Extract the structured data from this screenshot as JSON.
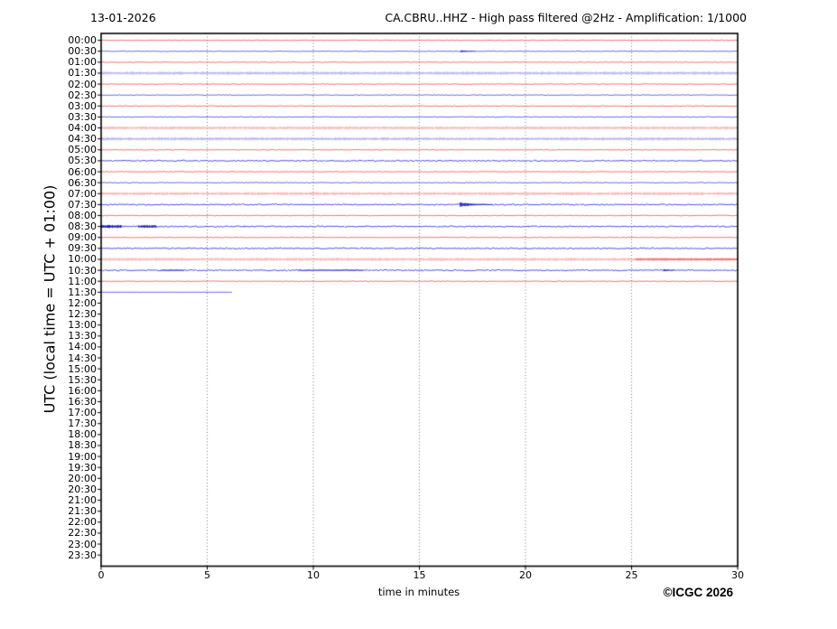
{
  "footer": {
    "copyright": "©ICGC 2026"
  },
  "colors": {
    "background": "#ffffff",
    "frame": "#000000",
    "gridline": "#666666",
    "text": "#000000",
    "trace_red": {
      "base": "#ee5252",
      "light": "#f8a2a2",
      "dark": "#cc2222"
    },
    "trace_blue": {
      "base": "#4747e0",
      "light": "#a2a2f2",
      "dark": "#1c1cbe"
    }
  },
  "chart_data": {
    "type": "helicorder",
    "date": "13-01-2026",
    "title": "CA.CBRU..HHZ - High pass filtered @2Hz - Amplification: 1/1000",
    "xlabel": "time in minutes",
    "ylabel": "UTC (local time = UTC + 01:00)",
    "x_range": [
      0,
      30
    ],
    "x_ticks": [
      0,
      5,
      10,
      15,
      20,
      25,
      30
    ],
    "x_gridlines": [
      5,
      10,
      15,
      20,
      25
    ],
    "minutes_per_row": 30,
    "rows": [
      {
        "label": "00:00",
        "color": "red",
        "noise": "low"
      },
      {
        "label": "00:30",
        "color": "blue",
        "noise": "low",
        "events": [
          {
            "start": 16.95,
            "end": 17.6,
            "amp": 1.1,
            "decay": true,
            "shade": "dark"
          }
        ]
      },
      {
        "label": "01:00",
        "color": "red",
        "noise": "low"
      },
      {
        "label": "01:30",
        "color": "blue",
        "noise": "high"
      },
      {
        "label": "02:00",
        "color": "red",
        "noise": "low"
      },
      {
        "label": "02:30",
        "color": "blue",
        "noise": "low"
      },
      {
        "label": "03:00",
        "color": "red",
        "noise": "low"
      },
      {
        "label": "03:30",
        "color": "blue",
        "noise": "low"
      },
      {
        "label": "04:00",
        "color": "red",
        "noise": "high"
      },
      {
        "label": "04:30",
        "color": "blue",
        "noise": "high"
      },
      {
        "label": "05:00",
        "color": "red",
        "noise": "low"
      },
      {
        "label": "05:30",
        "color": "blue",
        "noise": "med"
      },
      {
        "label": "06:00",
        "color": "red",
        "noise": "low"
      },
      {
        "label": "06:30",
        "color": "blue",
        "noise": "low"
      },
      {
        "label": "07:00",
        "color": "red",
        "noise": "high"
      },
      {
        "label": "07:30",
        "color": "blue",
        "noise": "med",
        "events": [
          {
            "start": 16.9,
            "end": 18.4,
            "amp": 2.8,
            "decay": true,
            "shade": "dark"
          }
        ]
      },
      {
        "label": "08:00",
        "color": "red",
        "noise": "low"
      },
      {
        "label": "08:30",
        "color": "blue",
        "noise": "med",
        "events": [
          {
            "start": 0.0,
            "end": 0.95,
            "amp": 1.5,
            "decay": false,
            "shade": "dark"
          },
          {
            "start": 1.75,
            "end": 2.6,
            "amp": 1.2,
            "decay": false,
            "shade": "dark"
          }
        ]
      },
      {
        "label": "09:00",
        "color": "red",
        "noise": "low"
      },
      {
        "label": "09:30",
        "color": "blue",
        "noise": "med"
      },
      {
        "label": "10:00",
        "color": "red",
        "noise": "high",
        "events": [
          {
            "start": 25.2,
            "end": 30,
            "amp": 1.1,
            "decay": false,
            "shade": "base"
          }
        ]
      },
      {
        "label": "10:30",
        "color": "blue",
        "noise": "med",
        "events": [
          {
            "start": 2.8,
            "end": 3.9,
            "amp": 0.75,
            "decay": false,
            "shade": "base"
          },
          {
            "start": 9.3,
            "end": 12.3,
            "amp": 0.7,
            "decay": false,
            "shade": "base"
          },
          {
            "start": 26.5,
            "end": 27.0,
            "amp": 1.2,
            "decay": true,
            "shade": "dark"
          }
        ]
      },
      {
        "label": "11:00",
        "color": "red",
        "noise": "low"
      },
      {
        "label": "11:30",
        "color": "blue",
        "noise": "flat",
        "end_min": 6.2
      },
      {
        "label": "12:00",
        "color": "red",
        "noise": "none"
      },
      {
        "label": "12:30",
        "color": "blue",
        "noise": "none"
      },
      {
        "label": "13:00",
        "color": "red",
        "noise": "none"
      },
      {
        "label": "13:30",
        "color": "blue",
        "noise": "none"
      },
      {
        "label": "14:00",
        "color": "red",
        "noise": "none"
      },
      {
        "label": "14:30",
        "color": "blue",
        "noise": "none"
      },
      {
        "label": "15:00",
        "color": "red",
        "noise": "none"
      },
      {
        "label": "15:30",
        "color": "blue",
        "noise": "none"
      },
      {
        "label": "16:00",
        "color": "red",
        "noise": "none"
      },
      {
        "label": "16:30",
        "color": "blue",
        "noise": "none"
      },
      {
        "label": "17:00",
        "color": "red",
        "noise": "none"
      },
      {
        "label": "17:30",
        "color": "blue",
        "noise": "none"
      },
      {
        "label": "18:00",
        "color": "red",
        "noise": "none"
      },
      {
        "label": "18:30",
        "color": "blue",
        "noise": "none"
      },
      {
        "label": "19:00",
        "color": "red",
        "noise": "none"
      },
      {
        "label": "19:30",
        "color": "blue",
        "noise": "none"
      },
      {
        "label": "20:00",
        "color": "red",
        "noise": "none"
      },
      {
        "label": "20:30",
        "color": "blue",
        "noise": "none"
      },
      {
        "label": "21:00",
        "color": "red",
        "noise": "none"
      },
      {
        "label": "21:30",
        "color": "blue",
        "noise": "none"
      },
      {
        "label": "22:00",
        "color": "red",
        "noise": "none"
      },
      {
        "label": "22:30",
        "color": "blue",
        "noise": "none"
      },
      {
        "label": "23:00",
        "color": "red",
        "noise": "none"
      },
      {
        "label": "23:30",
        "color": "blue",
        "noise": "none"
      }
    ]
  }
}
